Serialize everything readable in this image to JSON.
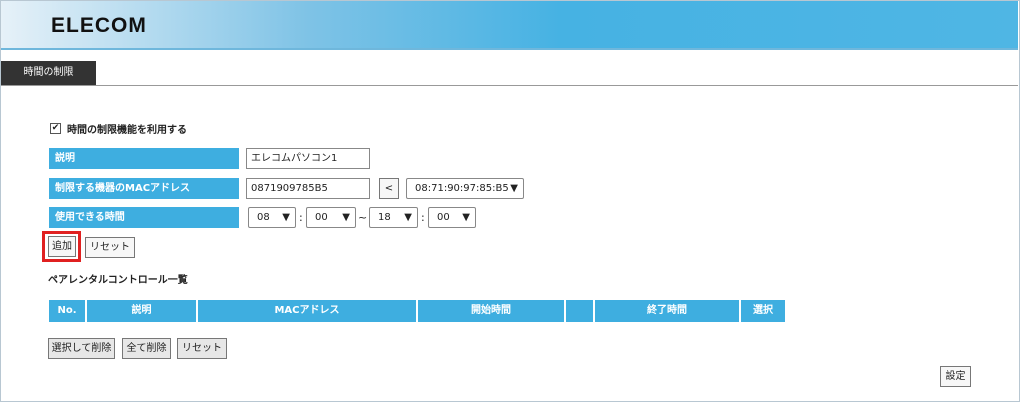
{
  "header": {
    "logo": "ELECOM"
  },
  "tab": {
    "label": "時間の制限"
  },
  "enable": {
    "checked": true,
    "check_mark": "✔",
    "label": "時間の制限機能を利用する"
  },
  "form": {
    "description": {
      "label": "説明",
      "value": "エレコムパソコン1"
    },
    "mac": {
      "label": "制限する機器のMACアドレス",
      "value": "0871909785B5",
      "copy_button": "<",
      "select_value": "08:71:90:97:85:B5"
    },
    "time": {
      "label": "使用できる時間",
      "start_hour": "08",
      "start_min": "00",
      "end_hour": "18",
      "end_min": "00",
      "colon": ":",
      "tilde": "~"
    },
    "add_button": "追加",
    "reset_button": "リセット"
  },
  "list": {
    "title": "ペアレンタルコントロール一覧",
    "columns": [
      "No.",
      "説明",
      "MACアドレス",
      "開始時間",
      "",
      "終了時間",
      "選択"
    ]
  },
  "actions": {
    "delete_selected": "選択して削除",
    "delete_all": "全て削除",
    "reset": "リセット",
    "apply": "設定"
  },
  "icons": {
    "chevron": "chevron-down-icon",
    "check": "check-icon"
  },
  "colors": {
    "accent": "#3eaee0",
    "tab": "#333333",
    "highlight": "#e02020"
  }
}
